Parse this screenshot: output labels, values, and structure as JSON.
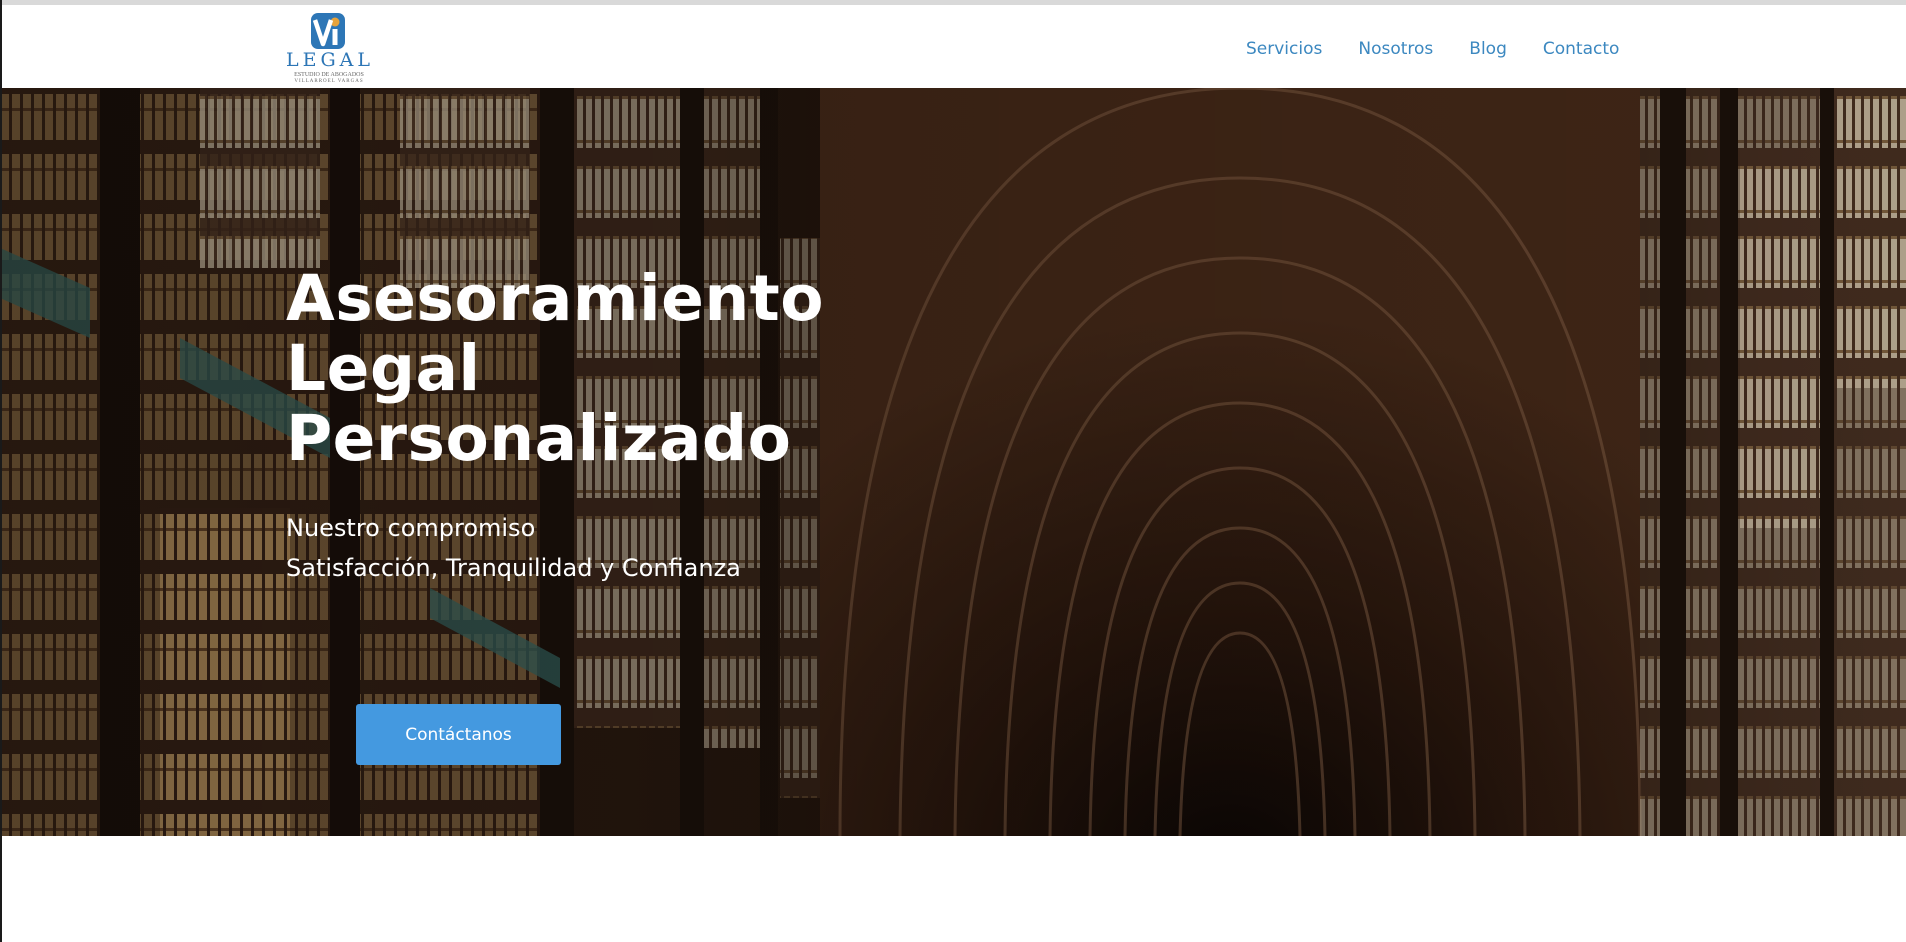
{
  "logo": {
    "monogram": "Vi",
    "wordmark": "LEGAL",
    "tagline": "ESTUDIO DE ABOGADOS",
    "firm_name": "VILLARROEL VARGAS",
    "colors": {
      "primary": "#2d76b6",
      "accent": "#e7a33b"
    }
  },
  "nav": {
    "items": [
      {
        "label": "Servicios"
      },
      {
        "label": "Nosotros"
      },
      {
        "label": "Blog"
      },
      {
        "label": "Contacto"
      }
    ],
    "color": "#3c88c0"
  },
  "hero": {
    "background": "library-hall-photo",
    "title_lines": [
      "Asesoramiento",
      "Legal",
      "Personalizado"
    ],
    "subtitle_lines": [
      "Nuestro compromiso",
      "Satisfacción, Tranquilidad y Confianza"
    ],
    "cta_label": "Contáctanos",
    "cta_color": "#4499e0"
  }
}
